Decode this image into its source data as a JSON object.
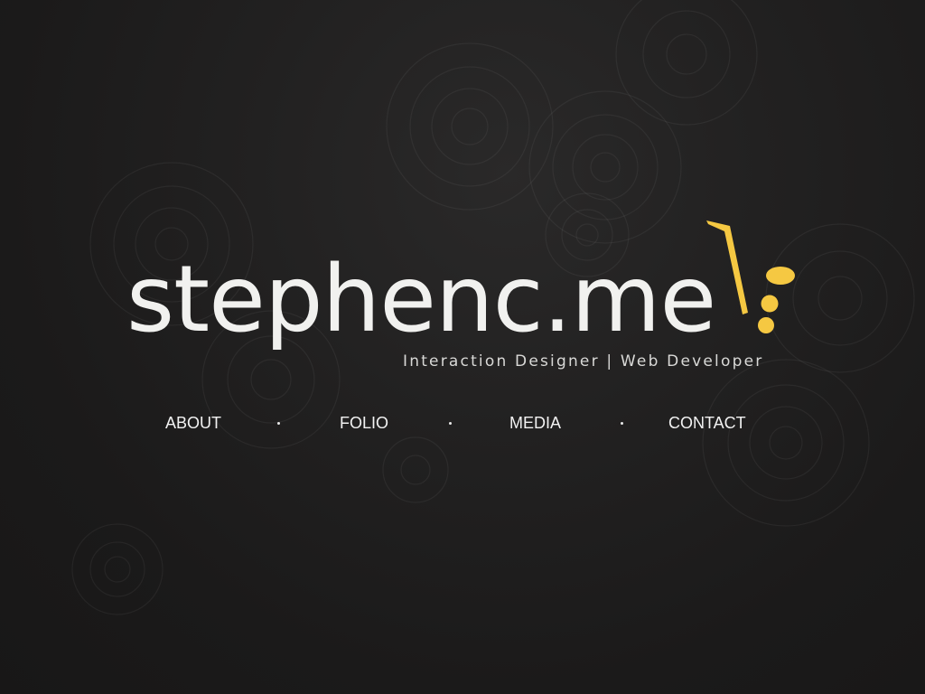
{
  "site": {
    "wordmark": "stephenc.me",
    "tagline": "Interaction Designer | Web Developer",
    "logo_icon": "saxophone-mark-icon",
    "colors": {
      "background": "#1c1b1b",
      "text": "#f1f1ef",
      "accent": "#f5c842"
    }
  },
  "nav": {
    "items": [
      {
        "label": "ABOUT"
      },
      {
        "label": "FOLIO"
      },
      {
        "label": "MEDIA"
      },
      {
        "label": "CONTACT"
      }
    ]
  }
}
